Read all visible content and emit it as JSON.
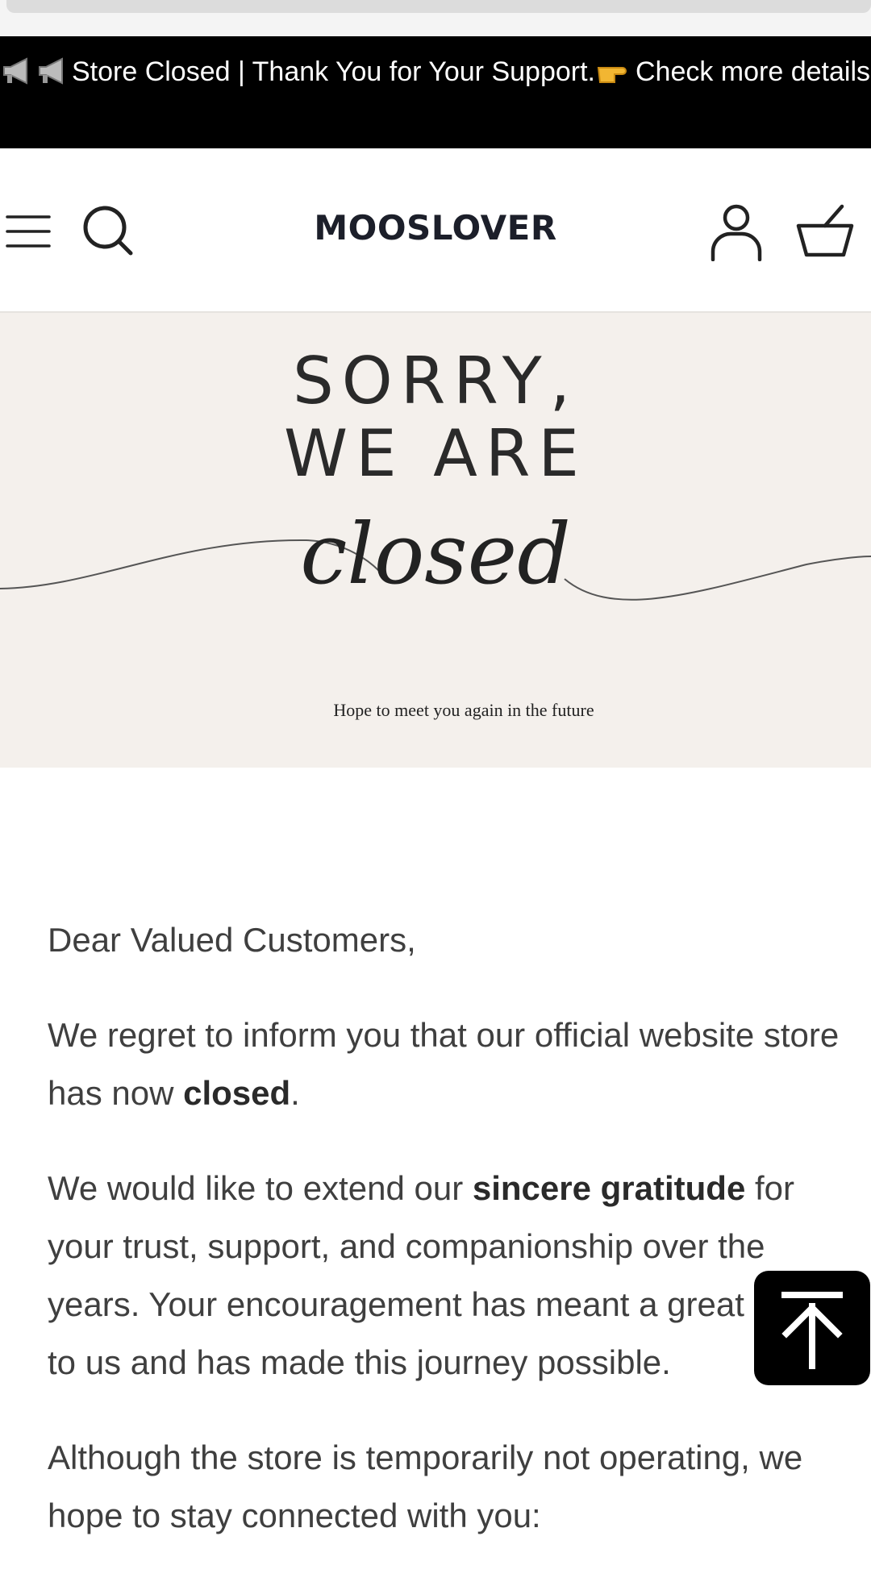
{
  "announcement": {
    "text": "Store Closed | Thank You for Your Support.",
    "link_text": "Check more details"
  },
  "header": {
    "logo": "MOOSLOVER"
  },
  "hero": {
    "line1": "SORRY,",
    "line2": "WE ARE",
    "script_word": "closed",
    "tagline": "Hope to meet you again in the future"
  },
  "letter": {
    "greeting": "Dear Valued Customers,",
    "p1_before": "We regret to inform you that our official website store has now ",
    "p1_bold": "closed",
    "p1_after": ".",
    "p2_before": "We would like to extend our ",
    "p2_bold": "sincere gratitude",
    "p2_after": " for your trust, support, and companionship over the years. Your encouragement has meant a great deal to us and has made this journey possible.",
    "p3": "Although the store is temporarily not operating, we hope to stay connected with you:"
  },
  "icons": {
    "menu": "hamburger-icon",
    "search": "search-icon",
    "account": "user-icon",
    "cart": "basket-icon",
    "back_to_top": "arrow-up-icon",
    "megaphone": "megaphone-icon",
    "pointing_hand": "pointing-hand-icon"
  },
  "colors": {
    "announcement_bg": "#000000",
    "hero_bg": "#f4f0ec",
    "logo": "#1c1f2a"
  }
}
